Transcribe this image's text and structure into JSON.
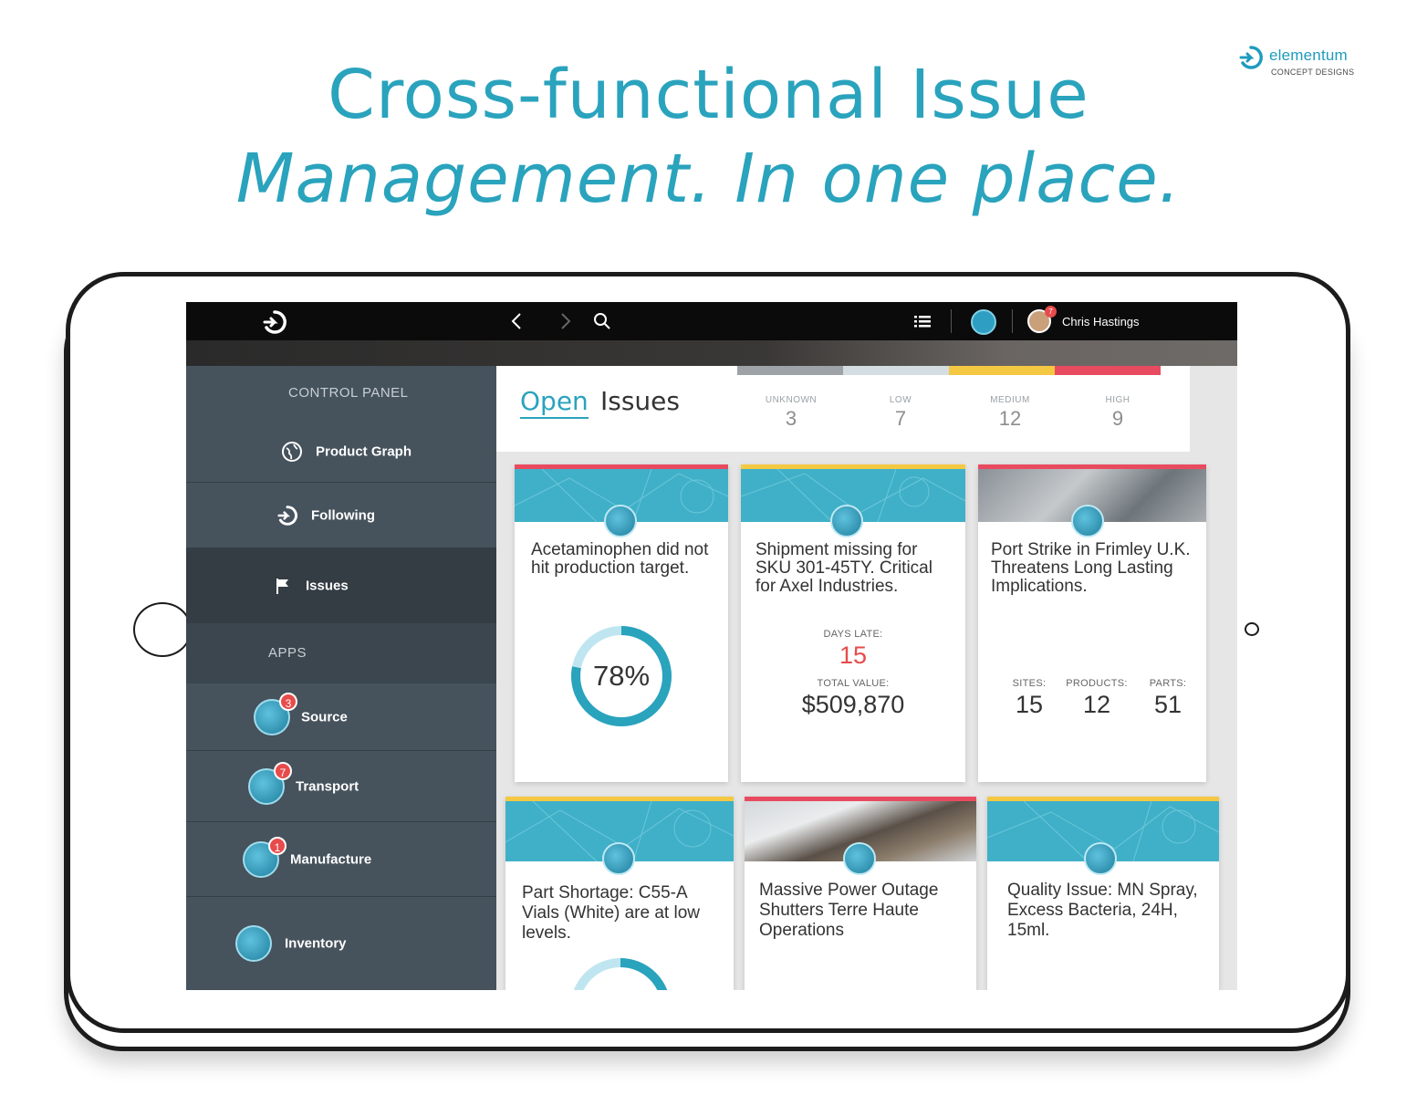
{
  "brand": {
    "name": "elementum",
    "tagline": "CONCEPT DESIGNS",
    "icon": "elementum-logo-icon"
  },
  "headline": {
    "line1": "Cross-functional Issue",
    "line2": "Management. In one place."
  },
  "topbar": {
    "logo_icon": "elementum-logo-icon",
    "back_icon": "chevron-left-icon",
    "forward_icon": "chevron-right-icon",
    "search_icon": "search-icon",
    "list_icon": "list-icon",
    "user": {
      "name": "Chris Hastings",
      "badge": "7"
    }
  },
  "sidebar": {
    "control_panel_label": "CONTROL PANEL",
    "items": [
      {
        "label": "Product Graph",
        "icon": "globe-icon"
      },
      {
        "label": "Following",
        "icon": "elementum-logo-icon"
      },
      {
        "label": "Issues",
        "icon": "flag-icon",
        "selected": true
      }
    ],
    "apps_label": "APPS",
    "apps": [
      {
        "label": "Source",
        "icon": "radar-icon",
        "badge": "3"
      },
      {
        "label": "Transport",
        "icon": "route-icon",
        "badge": "7"
      },
      {
        "label": "Manufacture",
        "icon": "factory-icon",
        "badge": "1"
      },
      {
        "label": "Inventory",
        "icon": "box-icon",
        "badge": ""
      }
    ]
  },
  "main": {
    "title_open": "Open",
    "title_issues": "Issues",
    "severity": [
      {
        "label": "UNKNOWN",
        "value": "3",
        "color": "#9ea3a8"
      },
      {
        "label": "LOW",
        "value": "7",
        "color": "#d4dde2"
      },
      {
        "label": "MEDIUM",
        "value": "12",
        "color": "#f4c842"
      },
      {
        "label": "HIGH",
        "value": "9",
        "color": "#e84b5f"
      }
    ]
  },
  "cards": [
    {
      "title": "Acetaminophen did not hit production target.",
      "severity_color": "#e84b5f",
      "donut_percent": 78,
      "donut_label": "78%",
      "icon": "factory-icon"
    },
    {
      "title": "Shipment missing for SKU 301-45TY. Critical for Axel Industries.",
      "severity_color": "#f4c842",
      "days_late_label": "DAYS LATE:",
      "days_late": "15",
      "total_value_label": "TOTAL VALUE:",
      "total_value": "$509,870",
      "icon": "route-icon"
    },
    {
      "title": "Port Strike in Frimley U.K. Threatens Long Lasting Implications.",
      "severity_color": "#e84b5f",
      "icon": "radar-icon",
      "metrics": [
        {
          "label": "SITES:",
          "value": "15"
        },
        {
          "label": "PRODUCTS:",
          "value": "12"
        },
        {
          "label": "PARTS:",
          "value": "51"
        }
      ]
    },
    {
      "title": "Part Shortage: C55-A Vials (White) are at low levels.",
      "severity_color": "#f4c842",
      "icon": "box-icon"
    },
    {
      "title": "Massive Power Outage Shutters Terre Haute Operations",
      "severity_color": "#e84b5f",
      "icon": "radar-icon"
    },
    {
      "title": "Quality Issue: MN Spray, Excess Bacteria, 24H, 15ml.",
      "severity_color": "#f4c842",
      "icon": "radar-icon"
    }
  ]
}
